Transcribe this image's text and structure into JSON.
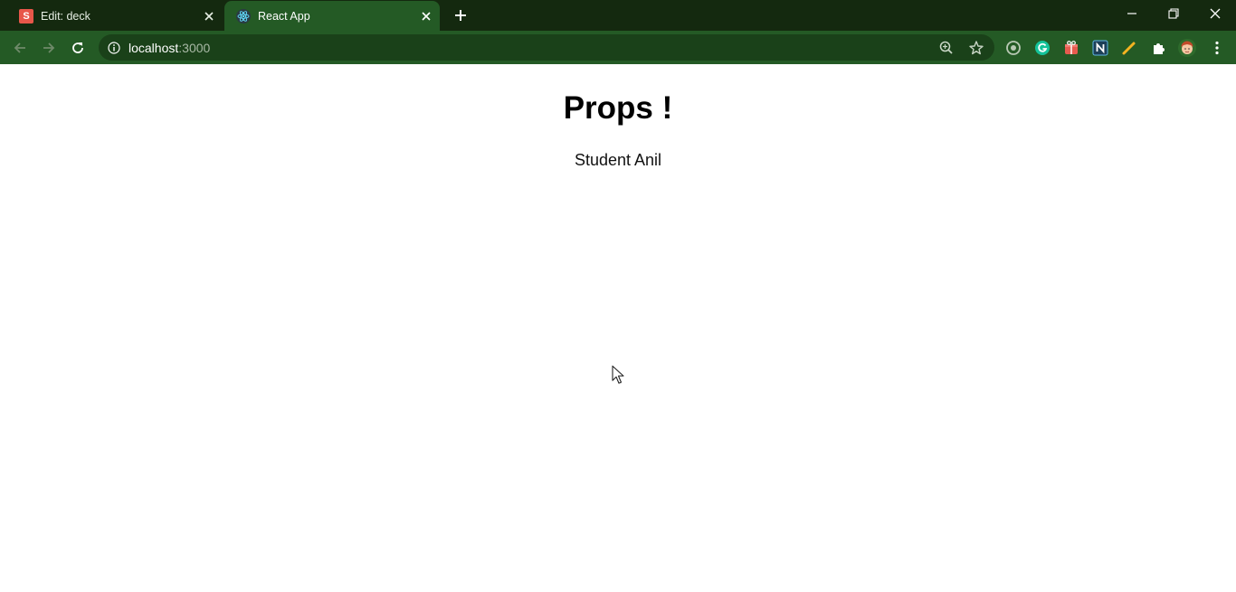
{
  "tabs": [
    {
      "title": "Edit: deck",
      "favicon": "S",
      "active": false
    },
    {
      "title": "React App",
      "favicon": "react-icon",
      "active": true
    }
  ],
  "address_bar": {
    "host": "localhost",
    "port": ":3000"
  },
  "extensions": [
    "circle-icon",
    "grammarly-icon",
    "gift-icon",
    "notion-n-icon",
    "pen-icon",
    "puzzle-icon",
    "avatar"
  ],
  "page": {
    "heading": "Props !",
    "text": "Student Anil"
  },
  "colors": {
    "tabstrip": "#14290f",
    "toolbar": "#245a25",
    "omnibox": "#1a4119"
  }
}
